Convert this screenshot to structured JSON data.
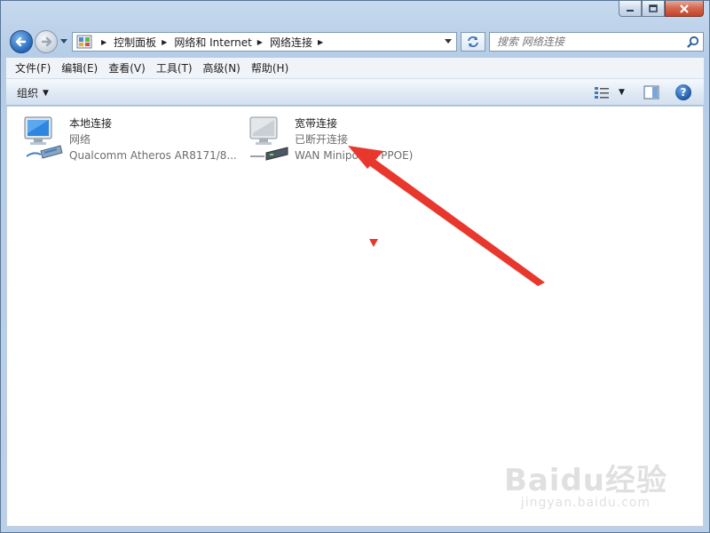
{
  "window": {
    "caption_buttons": [
      "minimize",
      "maximize",
      "close"
    ]
  },
  "address": {
    "crumbs": [
      "控制面板",
      "网络和 Internet",
      "网络连接"
    ],
    "search_placeholder": "搜索 网络连接"
  },
  "menu": {
    "items": [
      "文件(F)",
      "编辑(E)",
      "查看(V)",
      "工具(T)",
      "高级(N)",
      "帮助(H)"
    ]
  },
  "toolbar": {
    "organize_label": "组织",
    "help_label": "?"
  },
  "connections": [
    {
      "name": "本地连接",
      "status": "网络",
      "device": "Qualcomm Atheros AR8171/8...",
      "icon": "wired-network-adapter-icon"
    },
    {
      "name": "宽带连接",
      "status": "已断开连接",
      "device": "WAN Miniport (PPPOE)",
      "icon": "broadband-modem-icon"
    }
  ],
  "annotation": {
    "color": "#e8382e"
  },
  "watermark": {
    "logo": "Baidu经验",
    "url": "jingyan.baidu.com"
  }
}
